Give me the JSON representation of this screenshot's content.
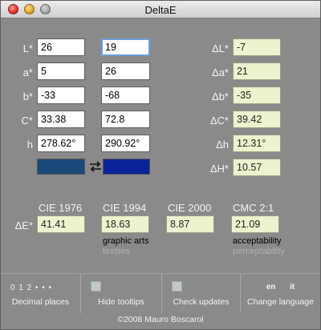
{
  "window": {
    "title": "DeltaE",
    "traffic_lights": {
      "close": "#d6231a",
      "minimize": "#d89a16",
      "zoom": "#9a9a9a"
    }
  },
  "inputs": {
    "rows": [
      {
        "label": "L*",
        "left": "26",
        "right": "19",
        "delta_label": "ΔL*",
        "delta": "-7"
      },
      {
        "label": "a*",
        "left": "5",
        "right": "26",
        "delta_label": "Δa*",
        "delta": "21"
      },
      {
        "label": "b*",
        "left": "-33",
        "right": "-68",
        "delta_label": "Δb*",
        "delta": "-35"
      },
      {
        "label": "C*",
        "left": "33.38",
        "right": "72.8",
        "delta_label": "ΔC*",
        "delta": "39.42"
      },
      {
        "label": "h",
        "left": "278.62°",
        "right": "290.92°",
        "delta_label": "Δh",
        "delta": "12.31°"
      }
    ],
    "delta_H_label": "ΔH*",
    "delta_H": "10.57",
    "swatches": {
      "left": "#1b4a7a",
      "right": "#0a2399"
    },
    "swap_icon": "swap-arrows-icon"
  },
  "delta_e": {
    "label": "ΔE*",
    "columns": [
      {
        "title": "CIE 1976",
        "value": "41.41",
        "note_primary": "",
        "note_secondary": ""
      },
      {
        "title": "CIE 1994",
        "value": "18.63",
        "note_primary": "graphic arts",
        "note_secondary": "textiles"
      },
      {
        "title": "CIE 2000",
        "value": "8.87",
        "note_primary": "",
        "note_secondary": ""
      },
      {
        "title": "CMC 2:1",
        "value": "21.09",
        "note_primary": "acceptability",
        "note_secondary": "perceptability"
      }
    ]
  },
  "toolbar": {
    "decimal_options": "0 1 2 • • •",
    "decimal_label": "Decimal places",
    "tooltips_label": "Hide tooltips",
    "updates_label": "Check updates",
    "lang_options_en": "en",
    "lang_options_it": "it",
    "language_label": "Change language"
  },
  "footer": "©2008 Mauro Boscarol"
}
